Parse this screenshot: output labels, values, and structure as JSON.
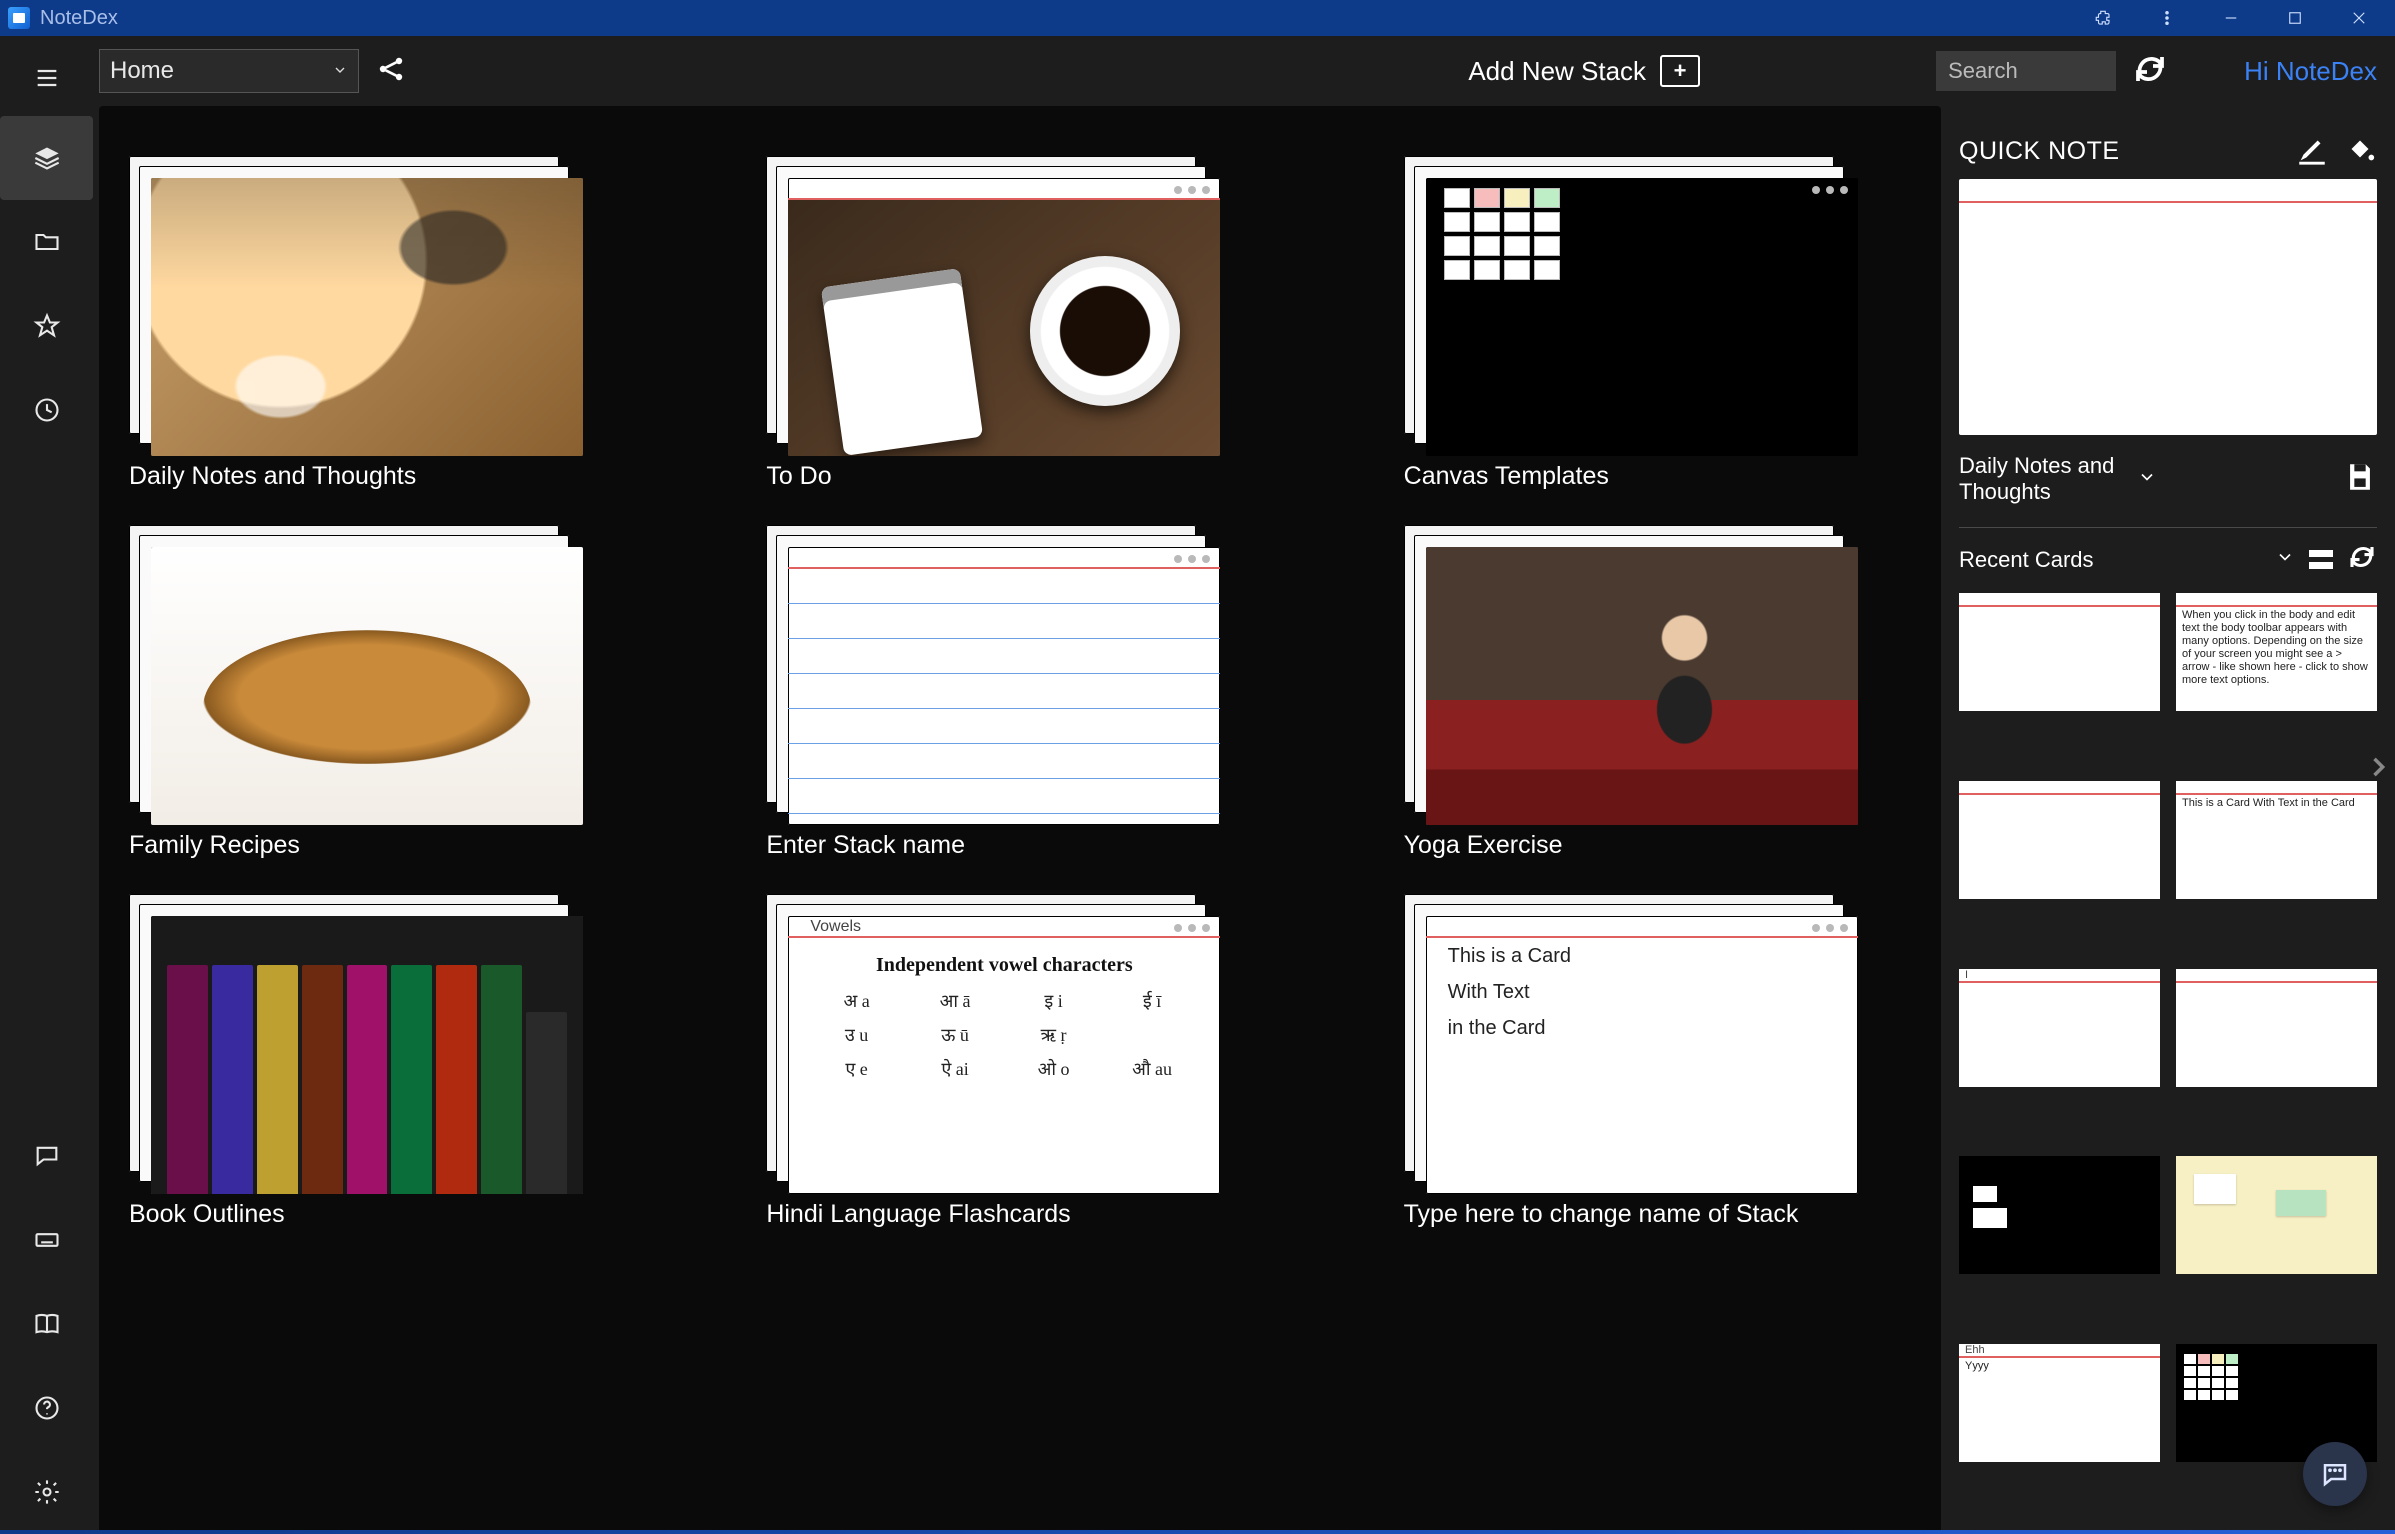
{
  "titlebar": {
    "app_name": "NoteDex"
  },
  "topbar": {
    "location_selected": "Home",
    "add_stack_label": "Add New Stack",
    "search_placeholder": "Search",
    "greeting": "Hi NoteDex"
  },
  "stacks": [
    {
      "label": "Daily Notes and Thoughts"
    },
    {
      "label": "To Do"
    },
    {
      "label": "Canvas Templates"
    },
    {
      "label": "Family Recipes"
    },
    {
      "label": "Enter Stack name"
    },
    {
      "label": "Yoga Exercise"
    },
    {
      "label": "Book Outlines"
    },
    {
      "label": "Hindi Language Flashcards",
      "card_title": "Vowels",
      "heading": "Independent vowel characters",
      "cells": [
        "अ a",
        "आ ā",
        "इ i",
        "ई ī",
        "उ u",
        "ऊ ū",
        "ऋ ṛ",
        "",
        "ए e",
        "ऐ ai",
        "ओ o",
        "औ au"
      ]
    },
    {
      "label": "Type here to change name of Stack",
      "card_text": "This is a Card\nWith Text\nin the Card"
    }
  ],
  "right_panel": {
    "quick_note_title": "QUICK NOTE",
    "quick_note_target": "Daily Notes and Thoughts",
    "recent_title": "Recent Cards",
    "thumbs": [
      {
        "kind": "blank"
      },
      {
        "kind": "text",
        "text": "When you click in the body and edit text the body toolbar appears with many options. Depending on the size of your screen you might see a > arrow - like shown here - click to show more text options."
      },
      {
        "kind": "blank"
      },
      {
        "kind": "text",
        "text": "This is a Card\nWith Text\nin the Card"
      },
      {
        "kind": "titled",
        "title": "I"
      },
      {
        "kind": "blank"
      },
      {
        "kind": "dark_blobs"
      },
      {
        "kind": "yellow_notes"
      },
      {
        "kind": "titled",
        "title": "Ehh",
        "text": "Yyyy"
      },
      {
        "kind": "dark_grid"
      }
    ]
  }
}
